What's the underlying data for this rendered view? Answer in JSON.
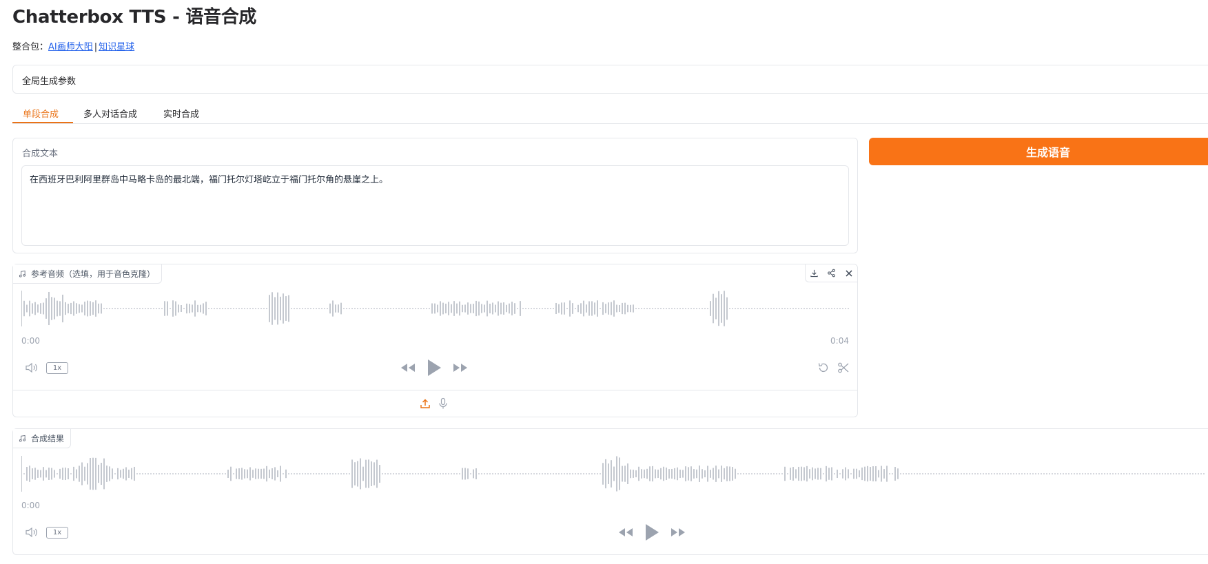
{
  "header": {
    "title": "Chatterbox TTS - 语音合成",
    "credit_prefix": "整合包：",
    "credit_link1": "AI画师大阳",
    "credit_separator": "|",
    "credit_link2": "知识星球"
  },
  "global_params": {
    "label": "全局生成参数"
  },
  "tabs": [
    {
      "label": "单段合成",
      "active": true
    },
    {
      "label": "多人对话合成",
      "active": false
    },
    {
      "label": "实时合成",
      "active": false
    }
  ],
  "text_panel": {
    "label": "合成文本",
    "value": "在西班牙巴利阿里群岛中马略卡岛的最北端，福门托尔灯塔屹立于福门托尔角的悬崖之上。"
  },
  "generate_button": {
    "label": "生成语音"
  },
  "reference_audio": {
    "label": "参考音频（选填，用于音色克隆）",
    "time_start": "0:00",
    "time_end": "0:04",
    "rate": "1x"
  },
  "result_audio": {
    "label": "合成结果",
    "time_start": "0:00",
    "rate": "1x"
  },
  "colors": {
    "accent": "#f97316",
    "tab_active": "#ea7317",
    "link": "#2563eb",
    "wave": "#9ca3af"
  }
}
